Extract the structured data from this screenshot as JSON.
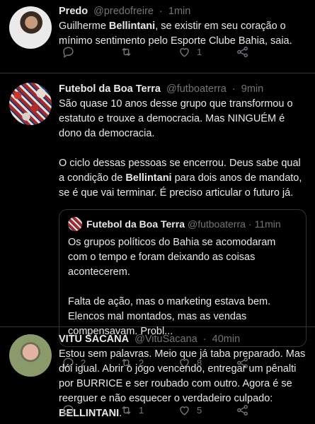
{
  "tweets": [
    {
      "name": "Predo",
      "handle": "@predofreire",
      "time": "1min",
      "text_parts": [
        "Guilherme ",
        "Bellintani",
        ", se existir em seu coração o mínimo sentimento pelo Esporte Clube Bahia, saia."
      ],
      "reply_count": "",
      "retweet_count": "",
      "like_count": "1"
    },
    {
      "name": "Futebol da Boa Terra",
      "handle": "@futboaterra",
      "time": "9min",
      "para1": "São quase 10 anos desse grupo que transformou o estatuto e trouxe a democracia. Mas NINGUÉM é dono da democracia.",
      "para2_parts": [
        "O ciclo dessas pessoas se encerrou. Deus sabe qual a condição de ",
        "Bellintani",
        " para dois anos de mandato, se é que vai terminar. É preciso articular o futuro já."
      ],
      "quote": {
        "name": "Futebol da Boa Terra",
        "handle": "@futboaterra",
        "time": "11min",
        "para1": "Os grupos políticos do Bahia se acomodaram com o tempo e foram deixando as coisas acontecerem.",
        "para2": "Falta de ação, mas o marketing estava bem. Elencos mal montados, mas as vendas compensavam. Probl..."
      },
      "reply_count": "2",
      "retweet_count": "2",
      "like_count": "8"
    },
    {
      "name": "VITU SACANA",
      "handle": "@VituSacana",
      "time": "40min",
      "text_parts": [
        "Estou sem palavras. Meio que já taba preparado. Mas dói igual. Abrir o jogo vencendo, entregar um pênalti por BURRICE  e ser roubado com outro. Agora é se reerguer e não esquecer o verdadeiro culpado: ",
        "BELLINTANI",
        "."
      ],
      "reply_count": "",
      "retweet_count": "1",
      "like_count": "5"
    }
  ],
  "separator": "·",
  "icons": [
    "reply-icon",
    "retweet-icon",
    "like-icon",
    "share-icon"
  ]
}
